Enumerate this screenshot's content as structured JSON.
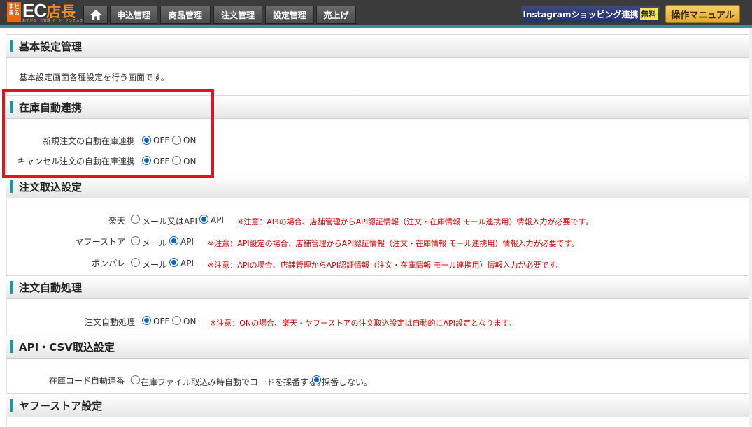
{
  "logo": {
    "badge": "まとまる",
    "ec": "EC",
    "tencho": "店長",
    "tagline": "おてがる一元管理 イーシーテンチョウ"
  },
  "nav": {
    "home_icon": "home-icon",
    "items": [
      "申込管理",
      "商品管理",
      "注文管理",
      "設定管理",
      "売上げ"
    ]
  },
  "header_right": {
    "instagram_label": "Instagramショッピング連携",
    "instagram_badge": "無料",
    "manual_label": "操作マニュアル"
  },
  "sections": {
    "basic": {
      "title": "基本設定管理",
      "description": "基本設定画面各種設定を行う画面です。"
    },
    "stock": {
      "title": "在庫自動連携",
      "rows": [
        {
          "label": "新規注文の自動在庫連携",
          "options": [
            "OFF",
            "ON"
          ],
          "selected": "OFF"
        },
        {
          "label": "キャンセル注文の自動在庫連携",
          "options": [
            "OFF",
            "ON"
          ],
          "selected": "OFF"
        }
      ]
    },
    "order_import": {
      "title": "注文取込設定",
      "rows": [
        {
          "label": "楽天",
          "options": [
            "メール又はAPI",
            "API"
          ],
          "selected": "API",
          "note": "※注意：APIの場合、店舗管理からAPI認証情報（注文・在庫情報 モール連携用）情報入力が必要です。"
        },
        {
          "label": "ヤフーストア",
          "options": [
            "メール",
            "API"
          ],
          "selected": "API",
          "note": "※注意：API設定の場合、店舗管理からAPI認証情報（注文・在庫情報 モール連携用）情報入力が必要です。"
        },
        {
          "label": "ポンパレ",
          "options": [
            "メール",
            "API"
          ],
          "selected": "API",
          "note": "※注意：APIの場合、店舗管理からAPI認証情報（注文・在庫情報 モール連携用）情報入力が必要です。"
        }
      ]
    },
    "order_auto": {
      "title": "注文自動処理",
      "rows": [
        {
          "label": "注文自動処理",
          "options": [
            "OFF",
            "ON"
          ],
          "selected": "OFF",
          "note": "※注意：ONの場合、楽天・ヤフーストアの注文取込設定は自動的にAPI設定となります。"
        }
      ]
    },
    "api_csv": {
      "title": "API・CSV取込設定",
      "rows": [
        {
          "label": "在庫コード自動連番",
          "options": [
            "在庫ファイル取込み時自動でコードを採番する。",
            "採番しない。"
          ],
          "selected": "採番しない。"
        }
      ]
    },
    "yahoo": {
      "title": "ヤフーストア設定"
    }
  },
  "colors": {
    "accent": "#2e8f99",
    "warning": "#d40000",
    "highlight": "#e0141e"
  }
}
